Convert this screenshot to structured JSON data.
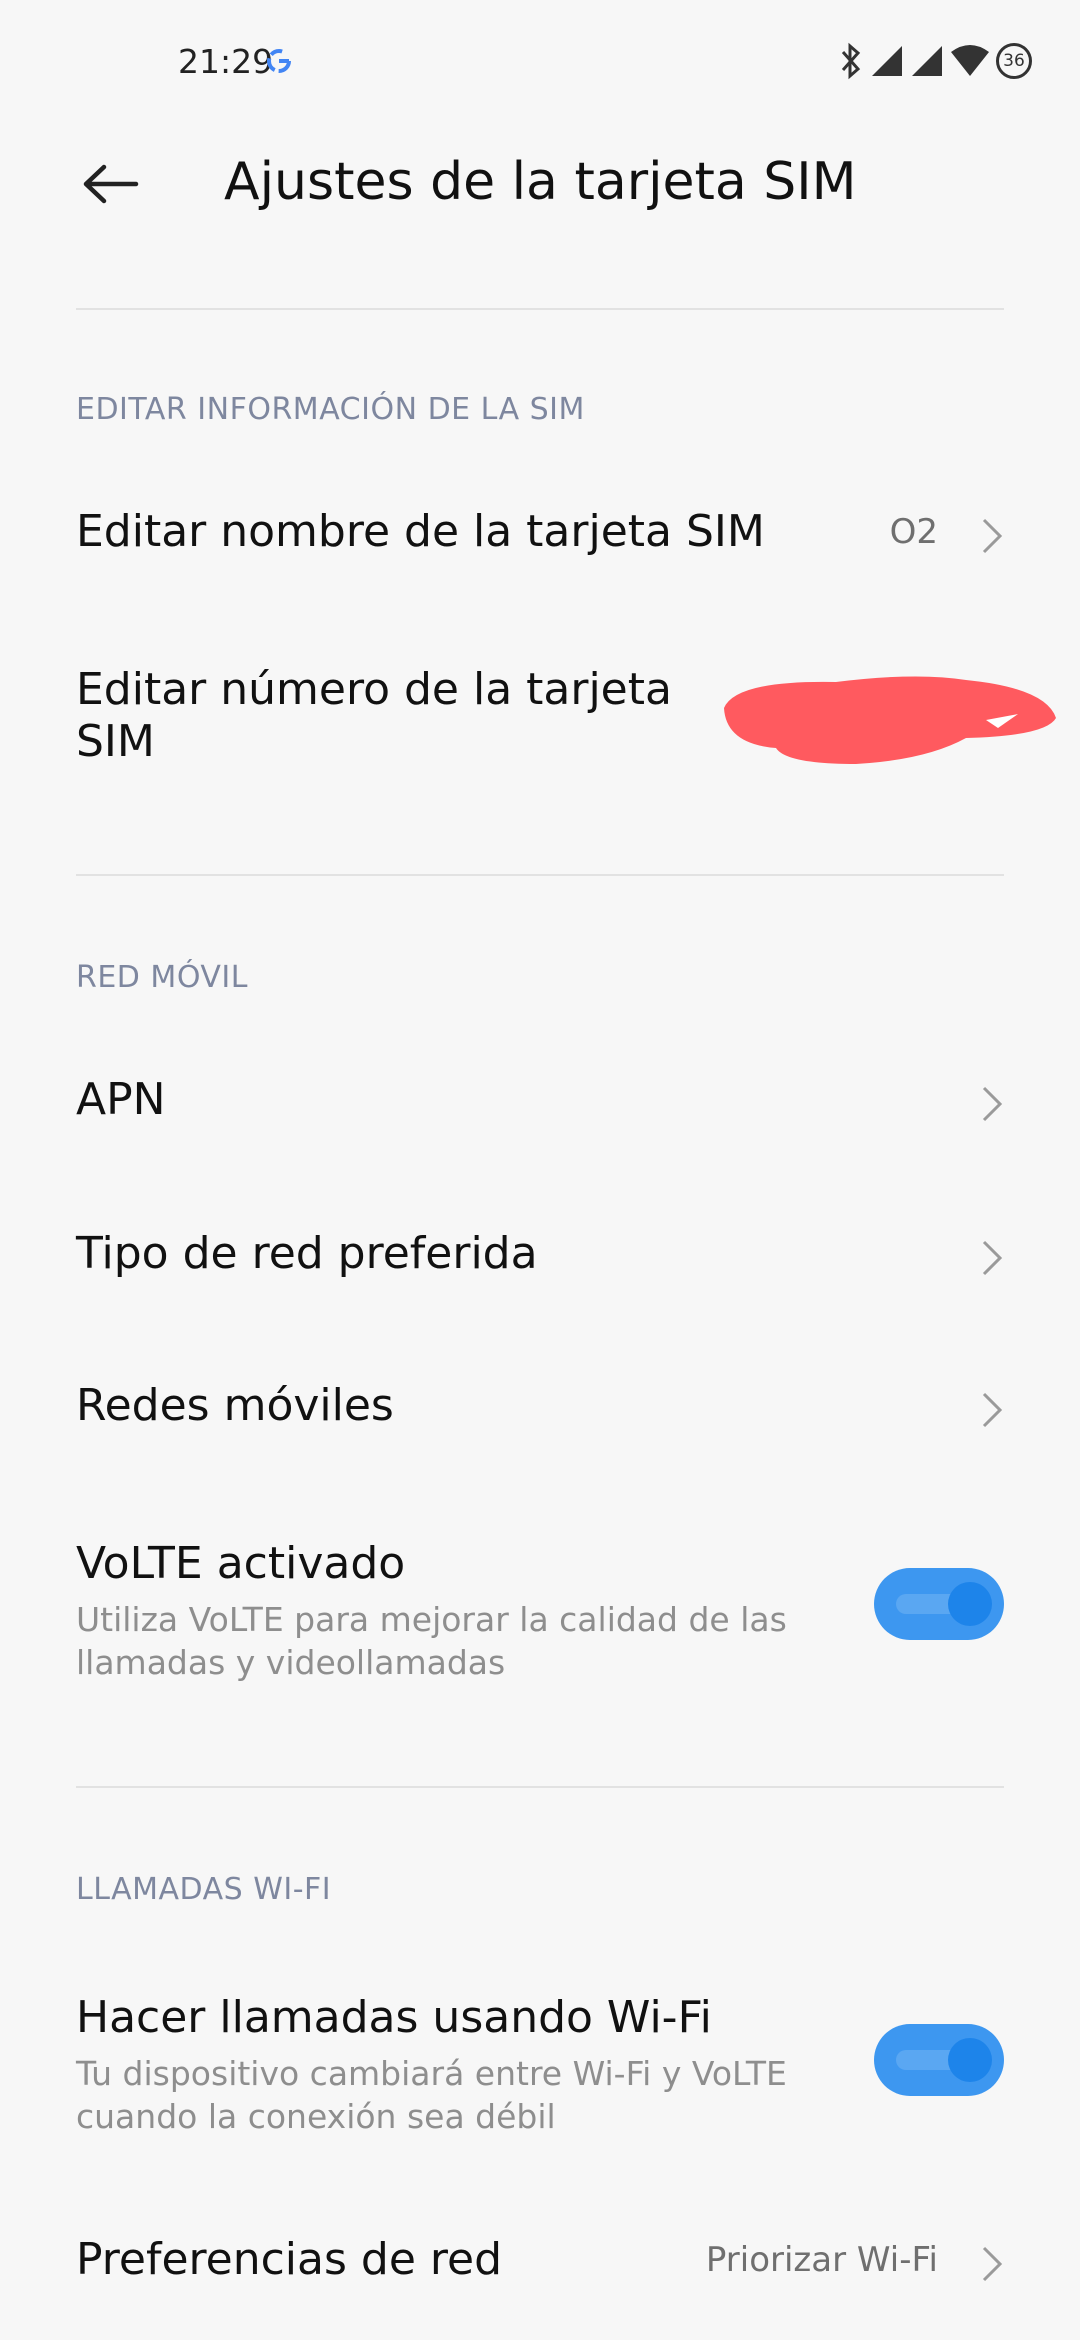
{
  "status_bar": {
    "time": "21:29",
    "battery_level": "36",
    "icons": [
      "google-icon",
      "bluetooth-icon",
      "signal-icon",
      "signal-icon",
      "wifi-icon",
      "battery-icon"
    ]
  },
  "header": {
    "title": "Ajustes de la tarjeta SIM",
    "back_icon": "arrow-left-icon"
  },
  "sections": {
    "sim_info": {
      "header": "EDITAR INFORMACIÓN DE LA SIM",
      "edit_name": {
        "title": "Editar nombre de la tarjeta SIM",
        "value": "O2"
      },
      "edit_number": {
        "title_line1": "Editar número de la tarjeta",
        "title_line2": "SIM"
      }
    },
    "mobile_network": {
      "header": "RED MÓVIL",
      "apn": {
        "title": "APN"
      },
      "network_type": {
        "title": "Tipo de red preferida"
      },
      "mobile_networks": {
        "title": "Redes móviles"
      },
      "volte": {
        "title": "VoLTE activado",
        "subtitle": "Utiliza VoLTE para mejorar la calidad de las llamadas y videollamadas",
        "enabled": true
      }
    },
    "wifi_calling": {
      "header": "LLAMADAS WI-FI",
      "wifi_calls": {
        "title": "Hacer llamadas usando Wi-Fi",
        "subtitle": "Tu dispositivo cambiará entre Wi-Fi y VoLTE cuando la conexión sea débil",
        "enabled": true
      },
      "network_prefs": {
        "title": "Preferencias de red",
        "value": "Priorizar Wi-Fi"
      }
    }
  },
  "colors": {
    "accent": "#3d97f0",
    "section_header": "#7e879f",
    "redaction": "#ff5a5f"
  }
}
